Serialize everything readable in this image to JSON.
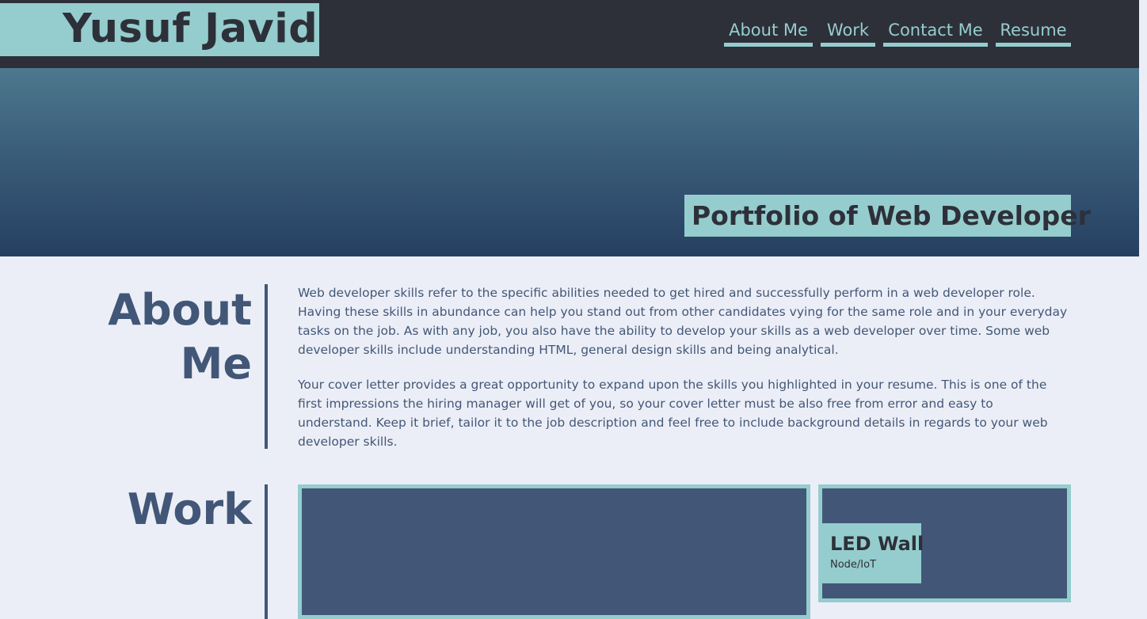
{
  "header": {
    "logo_text": "Yusuf Javid",
    "nav": [
      "About Me",
      "Work",
      "Contact Me",
      "Resume"
    ]
  },
  "hero": {
    "title": "Portfolio of Web Developer"
  },
  "about": {
    "heading": "About Me",
    "paragraphs": [
      "Web developer skills refer to the specific abilities needed to get hired and successfully perform in a web developer role. Having these skills in abundance can help you stand out from other candidates vying for the same role and in your everyday tasks on the job. As with any job, you also have the ability to develop your skills as a web developer over time. Some web developer skills include understanding HTML, general design skills and being analytical.",
      "Your cover letter provides a great opportunity to expand upon the skills you highlighted in your resume. This is one of the first impressions the hiring manager will get of you, so your cover letter must be also free from error and easy to understand. Keep it brief, tailor it to the job description and feel free to include background details in regards to your web developer skills."
    ]
  },
  "work": {
    "heading": "Work",
    "projects": [
      {
        "title": "LED Wall",
        "subtitle": "Node/IoT"
      }
    ]
  },
  "colors": {
    "header_bg": "#2e3039",
    "accent": "#95cdce",
    "text": "#425777",
    "page_bg": "#eceef7"
  }
}
